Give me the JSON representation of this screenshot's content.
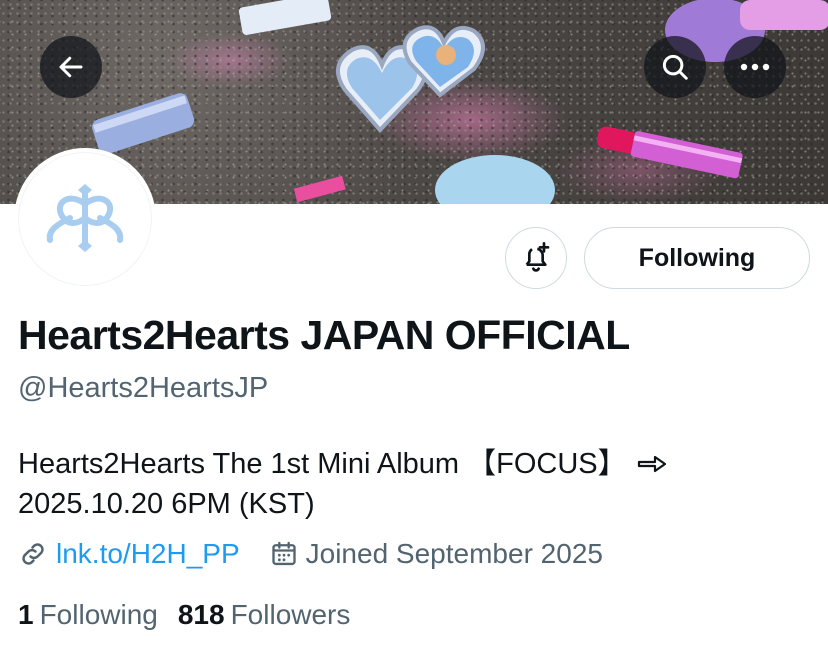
{
  "header": {
    "back_icon": "arrow-left-icon",
    "search_icon": "search-icon",
    "more_icon": "more-horizontal-icon"
  },
  "profile": {
    "display_name": "Hearts2Hearts JAPAN OFFICIAL",
    "handle": "@Hearts2HeartsJP",
    "bio_line1": "Hearts2Hearts The 1st Mini Album 【FOCUS】",
    "bio_line2": "2025.10.20 6PM (KST)",
    "link": "lnk.to/H2H_PP",
    "joined": "Joined September 2025",
    "following_count": "1",
    "following_label": "Following",
    "followers_count": "818",
    "followers_label": "Followers",
    "follow_button_label": "Following",
    "notify_icon": "bell-plus-icon",
    "link_icon": "link-icon",
    "calendar_icon": "calendar-icon",
    "bio_icon": "right-arrow-emoji-icon"
  },
  "colors": {
    "link": "#1d9bf0",
    "secondary_text": "#536471",
    "primary_text": "#0f1419",
    "avatar_logo": "#a9cdef"
  }
}
